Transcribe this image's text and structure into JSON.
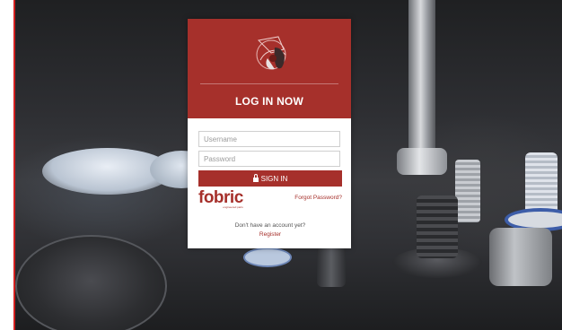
{
  "login": {
    "title": "LOG IN NOW",
    "username_placeholder": "Username",
    "password_placeholder": "Password",
    "sign_in_label": "SIGN IN",
    "forgot_password": "Forgot Password?",
    "no_account_text": "Don't have an account yet?",
    "register_label": "Register"
  },
  "brand": {
    "name": "fobric",
    "tagline": "engineered parts"
  },
  "colors": {
    "accent": "#a6302b",
    "left_edge_line": "#d11f1f"
  },
  "icons": {
    "logo": "abstract-sphere-logo-icon",
    "lock": "lock-icon"
  }
}
